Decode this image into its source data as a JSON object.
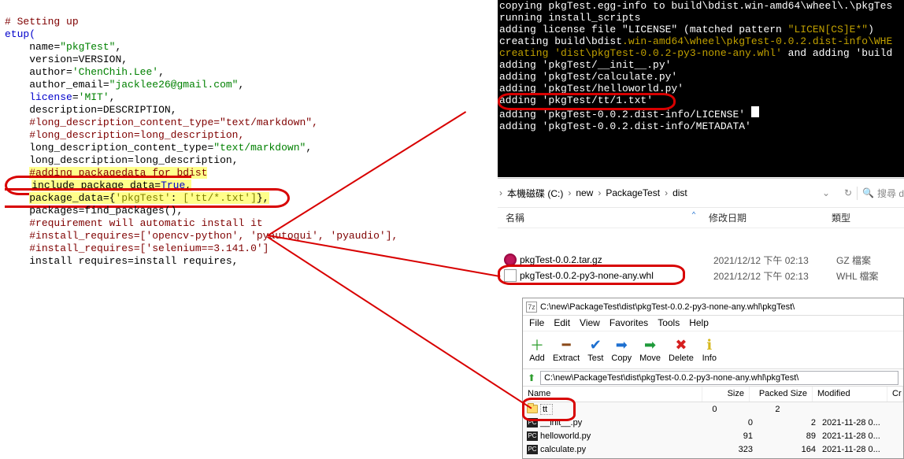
{
  "code": {
    "setting_up": "# Setting up",
    "setup_open": "etup(",
    "name_key": "name",
    "name_val": "\"pkgTest\"",
    "version_key": "version",
    "version_val": "VERSION",
    "author_key": "author",
    "author_val": "'ChenChih.Lee'",
    "author_email_key": "author_email",
    "author_email_val": "\"jacklee26@gmail.com\"",
    "license_key": "license",
    "license_val": "'MIT'",
    "description_key": "description",
    "description_val": "DESCRIPTION",
    "c_ldct": "#long_description_content_type=\"text/markdown\",",
    "c_ld": "#long_description=long_description,",
    "ldct_key": "long_description_content_type",
    "ldct_val": "\"text/markdown\"",
    "ld_key": "long_description",
    "ld_val": "long_description",
    "c_addpkg": "#adding packagedata for bdist",
    "ipd_key": "include_package_data",
    "ipd_val": "True",
    "pd_key": "package_data",
    "pd_open": "={",
    "pd_k": "'pkgTest'",
    "pd_v": "['tt/*.txt']",
    "pd_close": "},",
    "packages": "packages=find_packages(),",
    "c_req": "#requirement will automatic install it",
    "c_ir1": "#install_requires=['opencv-python', 'pyautogui', 'pyaudio'],",
    "c_ir2": "#install_requires=['selenium==3.141.0']",
    "ir": "install requires=install requires,"
  },
  "terminal": {
    "l0": "copying pkgTest.egg-info to build\\bdist.win-amd64\\wheel\\.\\pkgTes",
    "l1": "running install_scripts",
    "l2a": "adding license file \"LICENSE\" (matched pattern ",
    "l2b": "\"LICEN[CS]E*\"",
    "l2c": ")",
    "l3a": "creating build\\bdist",
    "l3b": ".win-amd64\\wheel\\pkgTest-0.0.2.dist-info\\WHE",
    "l4a": "creating ",
    "l4b": "'dist\\pkgTest-0.0.2-py3-none-any.whl'",
    "l4c": " and adding 'build",
    "l5": "adding 'pkgTest/__init__.py'",
    "l6": "adding 'pkgTest/calculate.py'",
    "l7": "adding 'pkgTest/helloworld.py'",
    "l8": "adding 'pkgTest/tt/1.txt'",
    "l9a": "adding 'pkgTest-0.0.2.dist-info/LICENSE'",
    "l10": "adding 'pkgTest-0.0.2.dist-info/METADATA'"
  },
  "explorer": {
    "drive": "本機磁碟 (C:)",
    "p1": "new",
    "p2": "PackageTest",
    "p3": "dist",
    "search_placeholder": "搜尋 d"
  },
  "filelist": {
    "h_name": "名稱",
    "h_date": "修改日期",
    "h_type": "類型",
    "rows": [
      {
        "name": "pkgTest-0.0.2.tar.gz",
        "date": "2021/12/12 下午 02:13",
        "type": "GZ 檔案",
        "icon": "rasp"
      },
      {
        "name": "pkgTest-0.0.2-py3-none-any.whl",
        "date": "2021/12/12 下午 02:13",
        "type": "WHL 檔案",
        "icon": "whl"
      }
    ]
  },
  "sz": {
    "title_icon": "7z",
    "title": "C:\\new\\PackageTest\\dist\\pkgTest-0.0.2-py3-none-any.whl\\pkgTest\\",
    "menu": [
      "File",
      "Edit",
      "View",
      "Favorites",
      "Tools",
      "Help"
    ],
    "tools": [
      {
        "name": "Add",
        "glyph": "＋",
        "color": "#2e9e2e"
      },
      {
        "name": "Extract",
        "glyph": "━",
        "color": "#8a4a1a"
      },
      {
        "name": "Test",
        "glyph": "✔",
        "color": "#1e70d0"
      },
      {
        "name": "Copy",
        "glyph": "➡",
        "color": "#1e70d0"
      },
      {
        "name": "Move",
        "glyph": "➡",
        "color": "#1e9a3a"
      },
      {
        "name": "Delete",
        "glyph": "✖",
        "color": "#d61f1f"
      },
      {
        "name": "Info",
        "glyph": "ℹ",
        "color": "#d6b81f"
      }
    ],
    "path": "C:\\new\\PackageTest\\dist\\pkgTest-0.0.2-py3-none-any.whl\\pkgTest\\",
    "head": {
      "name": "Name",
      "size": "Size",
      "psize": "Packed Size",
      "mod": "Modified",
      "cr": "Cr"
    },
    "rows": [
      {
        "name": "tt",
        "size": "0",
        "psize": "2",
        "mod": "",
        "icon": "folder"
      },
      {
        "name": "__init__.py",
        "size": "0",
        "psize": "2",
        "mod": "2021-11-28 0...",
        "icon": "pc"
      },
      {
        "name": "helloworld.py",
        "size": "91",
        "psize": "89",
        "mod": "2021-11-28 0...",
        "icon": "pc"
      },
      {
        "name": "calculate.py",
        "size": "323",
        "psize": "164",
        "mod": "2021-11-28 0...",
        "icon": "pc"
      }
    ]
  }
}
